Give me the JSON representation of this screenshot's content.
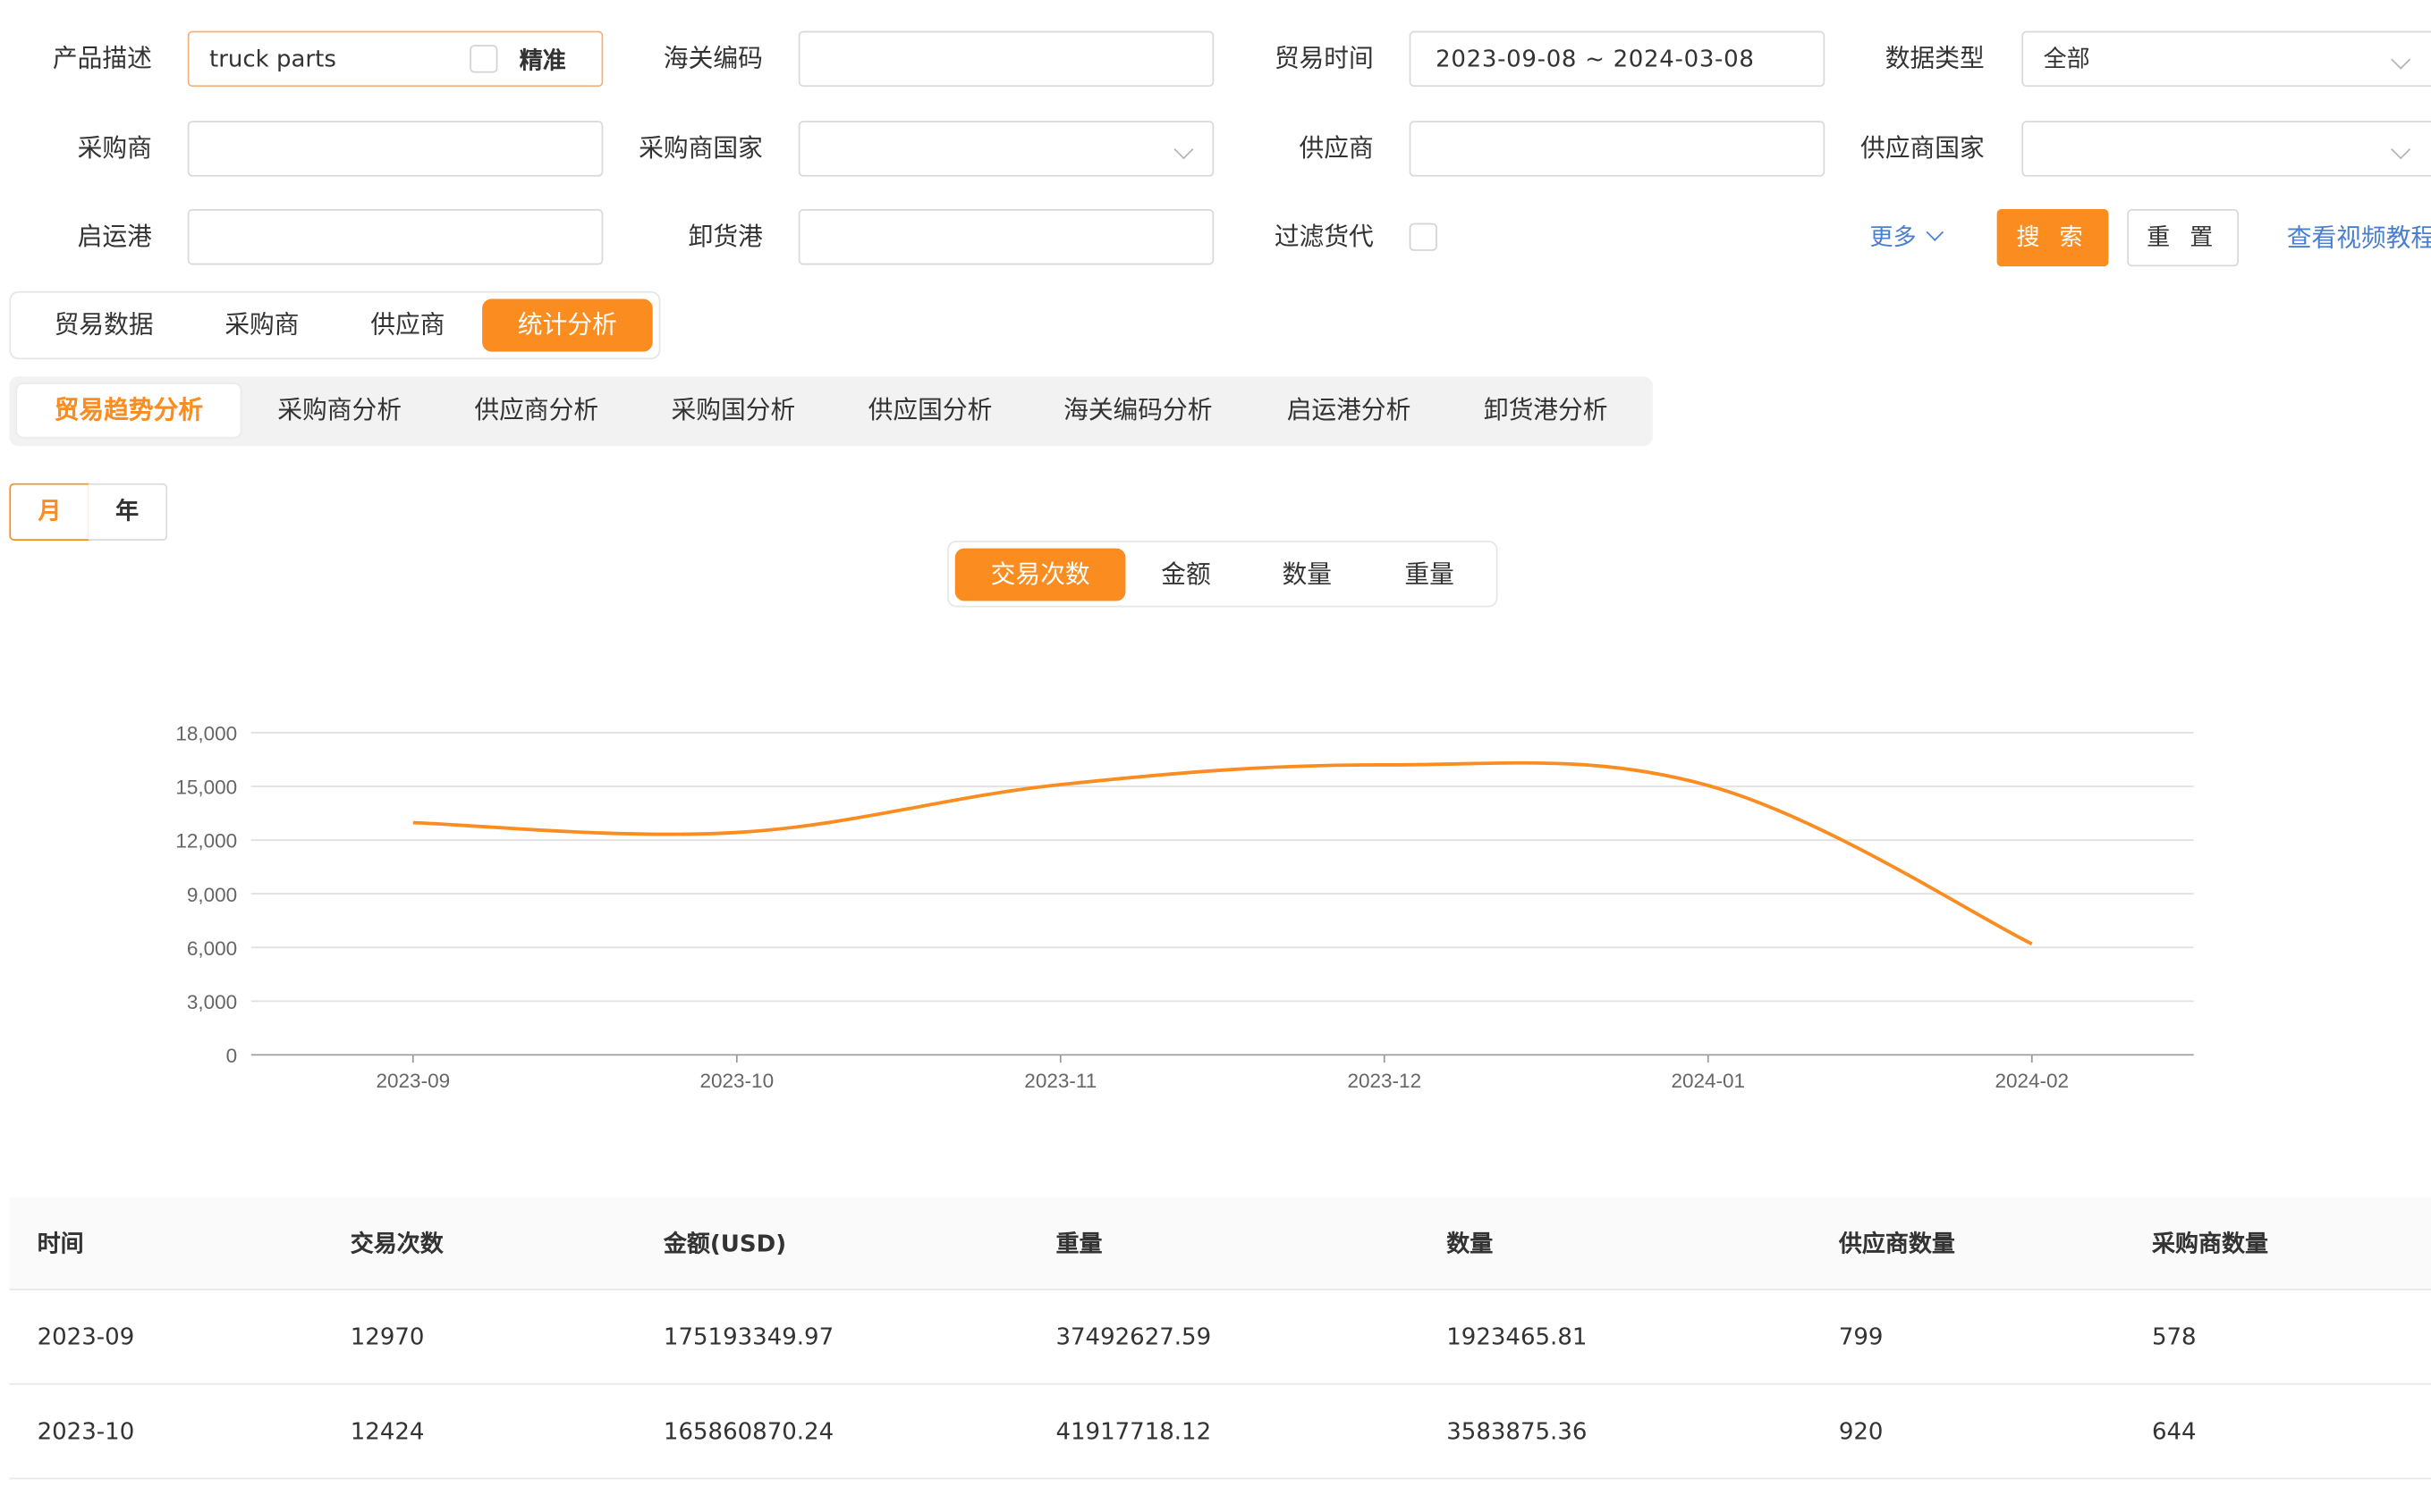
{
  "filters": {
    "product": {
      "label": "产品描述",
      "value": "truck parts",
      "exact_label": "精准"
    },
    "hs_code": {
      "label": "海关编码",
      "value": ""
    },
    "trade_time": {
      "label": "贸易时间",
      "value": "2023-09-08 ~ 2024-03-08"
    },
    "data_type": {
      "label": "数据类型",
      "value": "全部"
    },
    "buyer": {
      "label": "采购商",
      "value": ""
    },
    "buyer_country": {
      "label": "采购商国家",
      "value": ""
    },
    "supplier": {
      "label": "供应商",
      "value": ""
    },
    "supplier_country": {
      "label": "供应商国家",
      "value": ""
    },
    "origin_port": {
      "label": "启运港",
      "value": ""
    },
    "dest_port": {
      "label": "卸货港",
      "value": ""
    },
    "forwarder_filter": {
      "label": "过滤货代"
    },
    "more_label": "更多",
    "search_label": "搜 索",
    "reset_label": "重 置",
    "tutorial_link": "查看视频教程"
  },
  "main_tabs": [
    "贸易数据",
    "采购商",
    "供应商",
    "统计分析"
  ],
  "analysis_tabs": [
    "贸易趋势分析",
    "采购商分析",
    "供应商分析",
    "采购国分析",
    "供应国分析",
    "海关编码分析",
    "启运港分析",
    "卸货港分析"
  ],
  "period_toggle": [
    "月",
    "年"
  ],
  "metric_tabs": [
    "交易次数",
    "金额",
    "数量",
    "重量"
  ],
  "colors": {
    "accent": "#fb8c1f",
    "link": "#4a7fd0",
    "line": "#fb8c1f",
    "grid": "#e0e0e0"
  },
  "chart_data": {
    "type": "line",
    "x": [
      "2023-09",
      "2023-10",
      "2023-11",
      "2023-12",
      "2024-01",
      "2024-02"
    ],
    "series": [
      {
        "values": [
          12970,
          12424,
          15100,
          16200,
          15050,
          6200
        ]
      }
    ],
    "ylim": [
      0,
      18000
    ],
    "yticks": [
      "18,000",
      "15,000",
      "12,000",
      "9,000",
      "6,000",
      "3,000",
      "0"
    ],
    "grid": true
  },
  "table": {
    "headers": [
      "时间",
      "交易次数",
      "金额(USD)",
      "重量",
      "数量",
      "供应商数量",
      "采购商数量"
    ],
    "rows": [
      [
        "2023-09",
        "12970",
        "175193349.97",
        "37492627.59",
        "1923465.81",
        "799",
        "578"
      ],
      [
        "2023-10",
        "12424",
        "165860870.24",
        "41917718.12",
        "3583875.36",
        "920",
        "644"
      ]
    ]
  }
}
